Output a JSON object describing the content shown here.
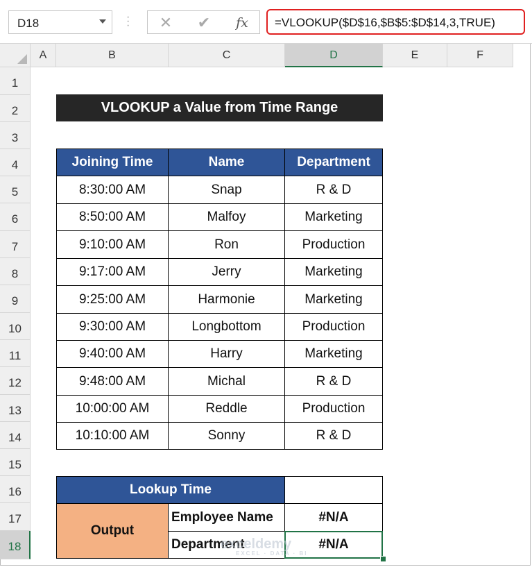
{
  "formula_bar": {
    "name_box": "D18",
    "cancel_glyph": "✕",
    "enter_glyph": "✔",
    "fx_glyph": "fx",
    "formula": "=VLOOKUP($D$16,$B$5:$D$14,3,TRUE)"
  },
  "columns": [
    "A",
    "B",
    "C",
    "D",
    "E",
    "F"
  ],
  "rows": [
    "1",
    "2",
    "3",
    "4",
    "5",
    "6",
    "7",
    "8",
    "9",
    "10",
    "11",
    "12",
    "13",
    "14",
    "15",
    "16",
    "17",
    "18"
  ],
  "sheet": {
    "title": "VLOOKUP a Value from Time Range",
    "headers": [
      "Joining Time",
      "Name",
      "Department"
    ],
    "data": [
      [
        "8:30:00 AM",
        "Snap",
        "R & D"
      ],
      [
        "8:50:00 AM",
        "Malfoy",
        "Marketing"
      ],
      [
        "9:10:00 AM",
        "Ron",
        "Production"
      ],
      [
        "9:17:00 AM",
        "Jerry",
        "Marketing"
      ],
      [
        "9:25:00 AM",
        "Harmonie",
        "Marketing"
      ],
      [
        "9:30:00 AM",
        "Longbottom",
        "Production"
      ],
      [
        "9:40:00 AM",
        "Harry",
        "Marketing"
      ],
      [
        "9:48:00 AM",
        "Michal",
        "R & D"
      ],
      [
        "10:00:00 AM",
        "Reddle",
        "Production"
      ],
      [
        "10:10:00 AM",
        "Sonny",
        "R & D"
      ]
    ],
    "lookup_label": "Lookup Time",
    "lookup_value": "",
    "output_label": "Output",
    "employee_label": "Employee Name",
    "employee_value": "#N/A",
    "department_label": "Department",
    "department_value": "#N/A"
  },
  "watermark": {
    "name": "exceldemy",
    "tagline": "EXCEL · DATA · BI"
  },
  "colors": {
    "header_blue": "#2f5597",
    "title_dark": "#262626",
    "output_orange": "#f4b183",
    "selection_green": "#217346",
    "formula_highlight": "#e02020"
  }
}
